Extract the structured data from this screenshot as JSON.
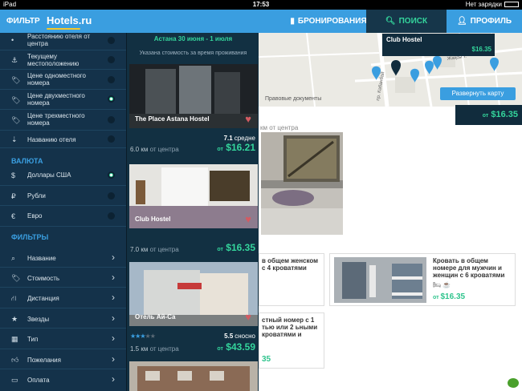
{
  "statusbar": {
    "device": "iPad",
    "time": "17:53",
    "charging": "Нет зарядки"
  },
  "topbar": {
    "filter_label": "ФИЛЬТР",
    "logo": "Hotels.ru",
    "booking_label": "БРОНИРОВАНИЯ",
    "search_label": "ПОИСК",
    "profile_label": "ПРОФИЛЬ"
  },
  "sidebar": {
    "sort_items": [
      {
        "label": "Расстоянию отеля от центра",
        "icon": "location-icon",
        "selected": false
      },
      {
        "label": "Текущему местоположению",
        "icon": "anchor-icon",
        "selected": false
      },
      {
        "label": "Цене одноместного номера",
        "icon": "price-tag-icon",
        "selected": false
      },
      {
        "label": "Цене двухместного номера",
        "icon": "price-tag-icon",
        "selected": true
      },
      {
        "label": "Цене трехместного номера",
        "icon": "price-tag-icon",
        "selected": false
      },
      {
        "label": "Названию отеля",
        "icon": "sort-alpha-icon",
        "selected": false
      }
    ],
    "currency_title": "ВАЛЮТА",
    "currencies": [
      {
        "label": "Доллары США",
        "symbol": "$",
        "selected": true
      },
      {
        "label": "Рубли",
        "symbol": "₽",
        "selected": false
      },
      {
        "label": "Евро",
        "symbol": "€",
        "selected": false
      }
    ],
    "filters_title": "ФИЛЬТРЫ",
    "filters": [
      {
        "label": "Название",
        "icon": "search-icon"
      },
      {
        "label": "Стоимость",
        "icon": "price-tag-icon"
      },
      {
        "label": "Дистанция",
        "icon": "road-icon"
      },
      {
        "label": "Звезды",
        "icon": "star-icon"
      },
      {
        "label": "Тип",
        "icon": "building-icon"
      },
      {
        "label": "Пожелания",
        "icon": "thumbs-up-icon"
      },
      {
        "label": "Оплата",
        "icon": "credit-card-icon"
      }
    ]
  },
  "list": {
    "date": "Астана 30 июня - 1 июля",
    "note": "Указана стоимость за время проживания",
    "hotels": [
      {
        "name": "The Place Astana Hostel",
        "rating": "7.1",
        "rating_word": "средне",
        "distance": "6.0 км",
        "distance_suffix": "от центра",
        "price_prefix": "от",
        "price": "$16.21"
      },
      {
        "name": "Club Hostel",
        "distance": "7.0 км",
        "distance_suffix": "от центра",
        "price_prefix": "от",
        "price": "$16.35"
      },
      {
        "name": "Отель Ай-Са",
        "rating": "5.5",
        "rating_word": "сносно",
        "distance": "1.5 км",
        "distance_suffix": "от центра",
        "price_prefix": "от",
        "price": "$43.59",
        "stars": 3
      }
    ]
  },
  "map": {
    "tooltip_name": "Club Hostel",
    "tooltip_price": "$16.35",
    "street_1": "пр. Кабанбай",
    "street_2": "Жақсы т.",
    "copyright": "Правовые документы",
    "expand_label": "Развернуть карту"
  },
  "detail": {
    "price_prefix": "от",
    "price": "$16.35",
    "distance_tail": "км от центра",
    "room_1": "в общем женском с 4 кроватями",
    "room_2": "Кровать в общем номере для мужчин и женщин с 6 кроватями",
    "room_2_price": "$16.35",
    "room_3": "стный номер с 1 тью или 2 ьными кроватями и",
    "room_3_price": "35"
  }
}
